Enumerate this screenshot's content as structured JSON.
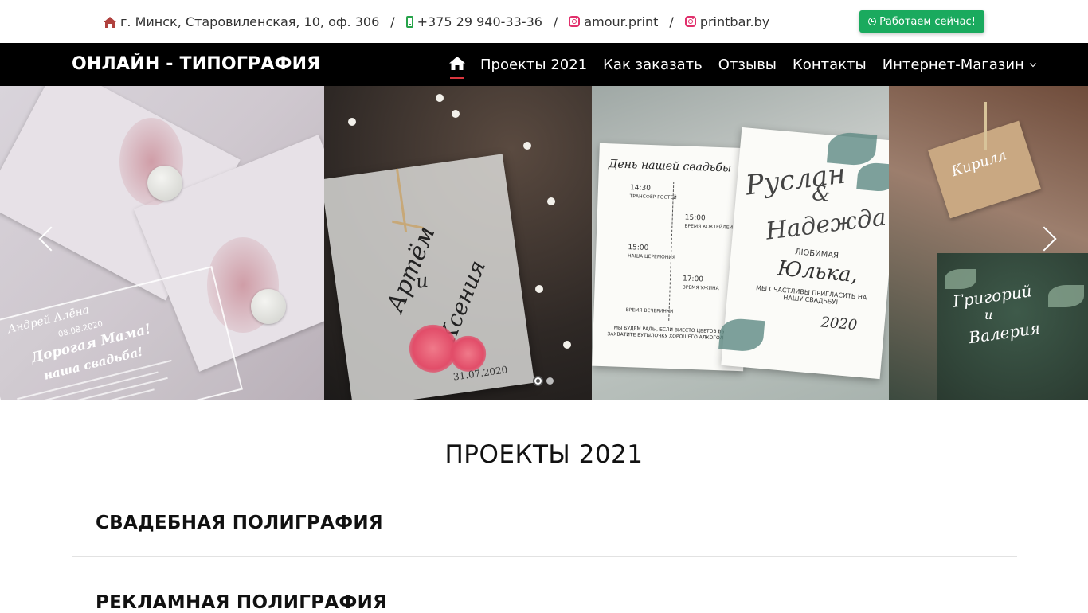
{
  "topbar": {
    "address": "г. Минск, Старовиленская, 10, оф. 306",
    "phone": "+375 29 940-33-36",
    "instagram_1": "amour.print",
    "instagram_2": "printbar.by",
    "separator": "/",
    "work_button": "Работаем сейчас!",
    "icons": {
      "address": "home-icon",
      "phone": "mobile-phone-icon",
      "instagram": "instagram-icon",
      "work": "clock-icon"
    },
    "colors": {
      "home_icon": "#b0413e",
      "phone_icon": "#27a34a",
      "instagram_icon": "#e1306c",
      "work_button": "#1aaa5e"
    }
  },
  "navbar": {
    "brand": "ОНЛАЙН - ТИПОГРАФИЯ",
    "items": [
      {
        "label": "Проекты 2021"
      },
      {
        "label": "Как заказать"
      },
      {
        "label": "Отзывы"
      },
      {
        "label": "Контакты"
      },
      {
        "label": "Интернет-Магазин"
      }
    ],
    "home_icon": "home-icon",
    "dropdown_icon": "chevron-down-icon",
    "active_indicator_color": "#d9363e"
  },
  "slider": {
    "texts": {
      "acrylic_names": "Андрей Алёна",
      "acrylic_date": "08.08.2020",
      "acrylic_heading": "Дорогая Мама!",
      "acrylic_line": "наша свадьба!",
      "vellum_names_1": "Артём",
      "vellum_and": "и",
      "vellum_names_2": "Ксения",
      "vellum_date": "31.07.2020",
      "timeline_title": "День нашей свадьбы",
      "timeline_times": [
        "14:30",
        "15:00",
        "15:00",
        "17:00"
      ],
      "timeline_events": [
        "ТРАНСФЕР ГОСТЕЙ",
        "ВРЕМЯ КОКТЕЙЛЕЙ",
        "НАША ЦЕРЕМОНИЯ",
        "ВРЕМЯ УЖИНА",
        "ВРЕМЯ ВЕЧЕРИНКИ"
      ],
      "timeline_note": "МЫ БУДЕМ РАДЫ, ЕСЛИ ВМЕСТО ЦВЕТОВ ВЫ ЗАХВАТИТЕ БУТЫЛОЧКУ ХОРОШЕГО АЛКОГОЛЯ :)",
      "card_names_1": "Руслан",
      "card_and": "&",
      "card_names_2": "Надежда",
      "card_addressee": "ЛЮБИМАЯ",
      "card_addressee_name": "Юлька,",
      "card_invite": "МЫ СЧАСТЛИВЫ ПРИГЛАСИТЬ НА НАШУ СВАДЬБУ!",
      "card_year": "2020",
      "tag_name": "Кирилл",
      "green_names_1": "Григорий",
      "green_and": "и",
      "green_names_2": "Валерия"
    },
    "prev_icon": "chevron-left-icon",
    "next_icon": "chevron-right-icon",
    "slide_count": 2,
    "active_slide": 1
  },
  "content": {
    "section_title": "ПРОЕКТЫ 2021",
    "categories": [
      {
        "label": "СВАДЕБНАЯ ПОЛИГРАФИЯ"
      },
      {
        "label": "РЕКЛАМНАЯ ПОЛИГРАФИЯ"
      }
    ]
  }
}
